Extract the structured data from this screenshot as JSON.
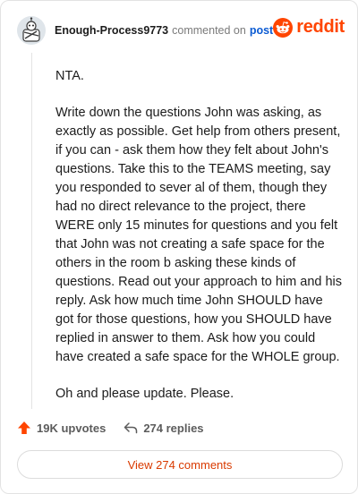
{
  "header": {
    "username": "Enough-Process9773",
    "commented": "commented on",
    "post_link": "post",
    "brand": "reddit"
  },
  "comment": {
    "paragraphs": [
      "NTA.",
      "Write down the questions John was asking, as exactly as possible. Get help from others present, if you can - ask them how they felt about John's questions. Take this to the TEAMS meeting, say you responded to sever al of them, though they had no direct relevance to the project, there WERE only 15 minutes for questions and you felt that John was not creating a safe space for the others in the room b asking these kinds of questions. Read out your approach to him and his reply. Ask how much time John SHOULD have got for those questions, how you SHOULD have replied in answer to them. Ask how you could have created a safe space for the WHOLE group.",
      "Oh and please update. Please."
    ]
  },
  "actions": {
    "upvotes": "19K upvotes",
    "replies": "274 replies"
  },
  "view_comments": "View 274 comments",
  "colors": {
    "accent": "#ff4500",
    "link": "#0b5bd3",
    "view_button_text": "#d93a00"
  },
  "icons": {
    "upvote": "arrow-up-icon",
    "reply": "reply-arrow-icon",
    "brand": "reddit-snoo-icon",
    "avatar": "user-avatar"
  }
}
